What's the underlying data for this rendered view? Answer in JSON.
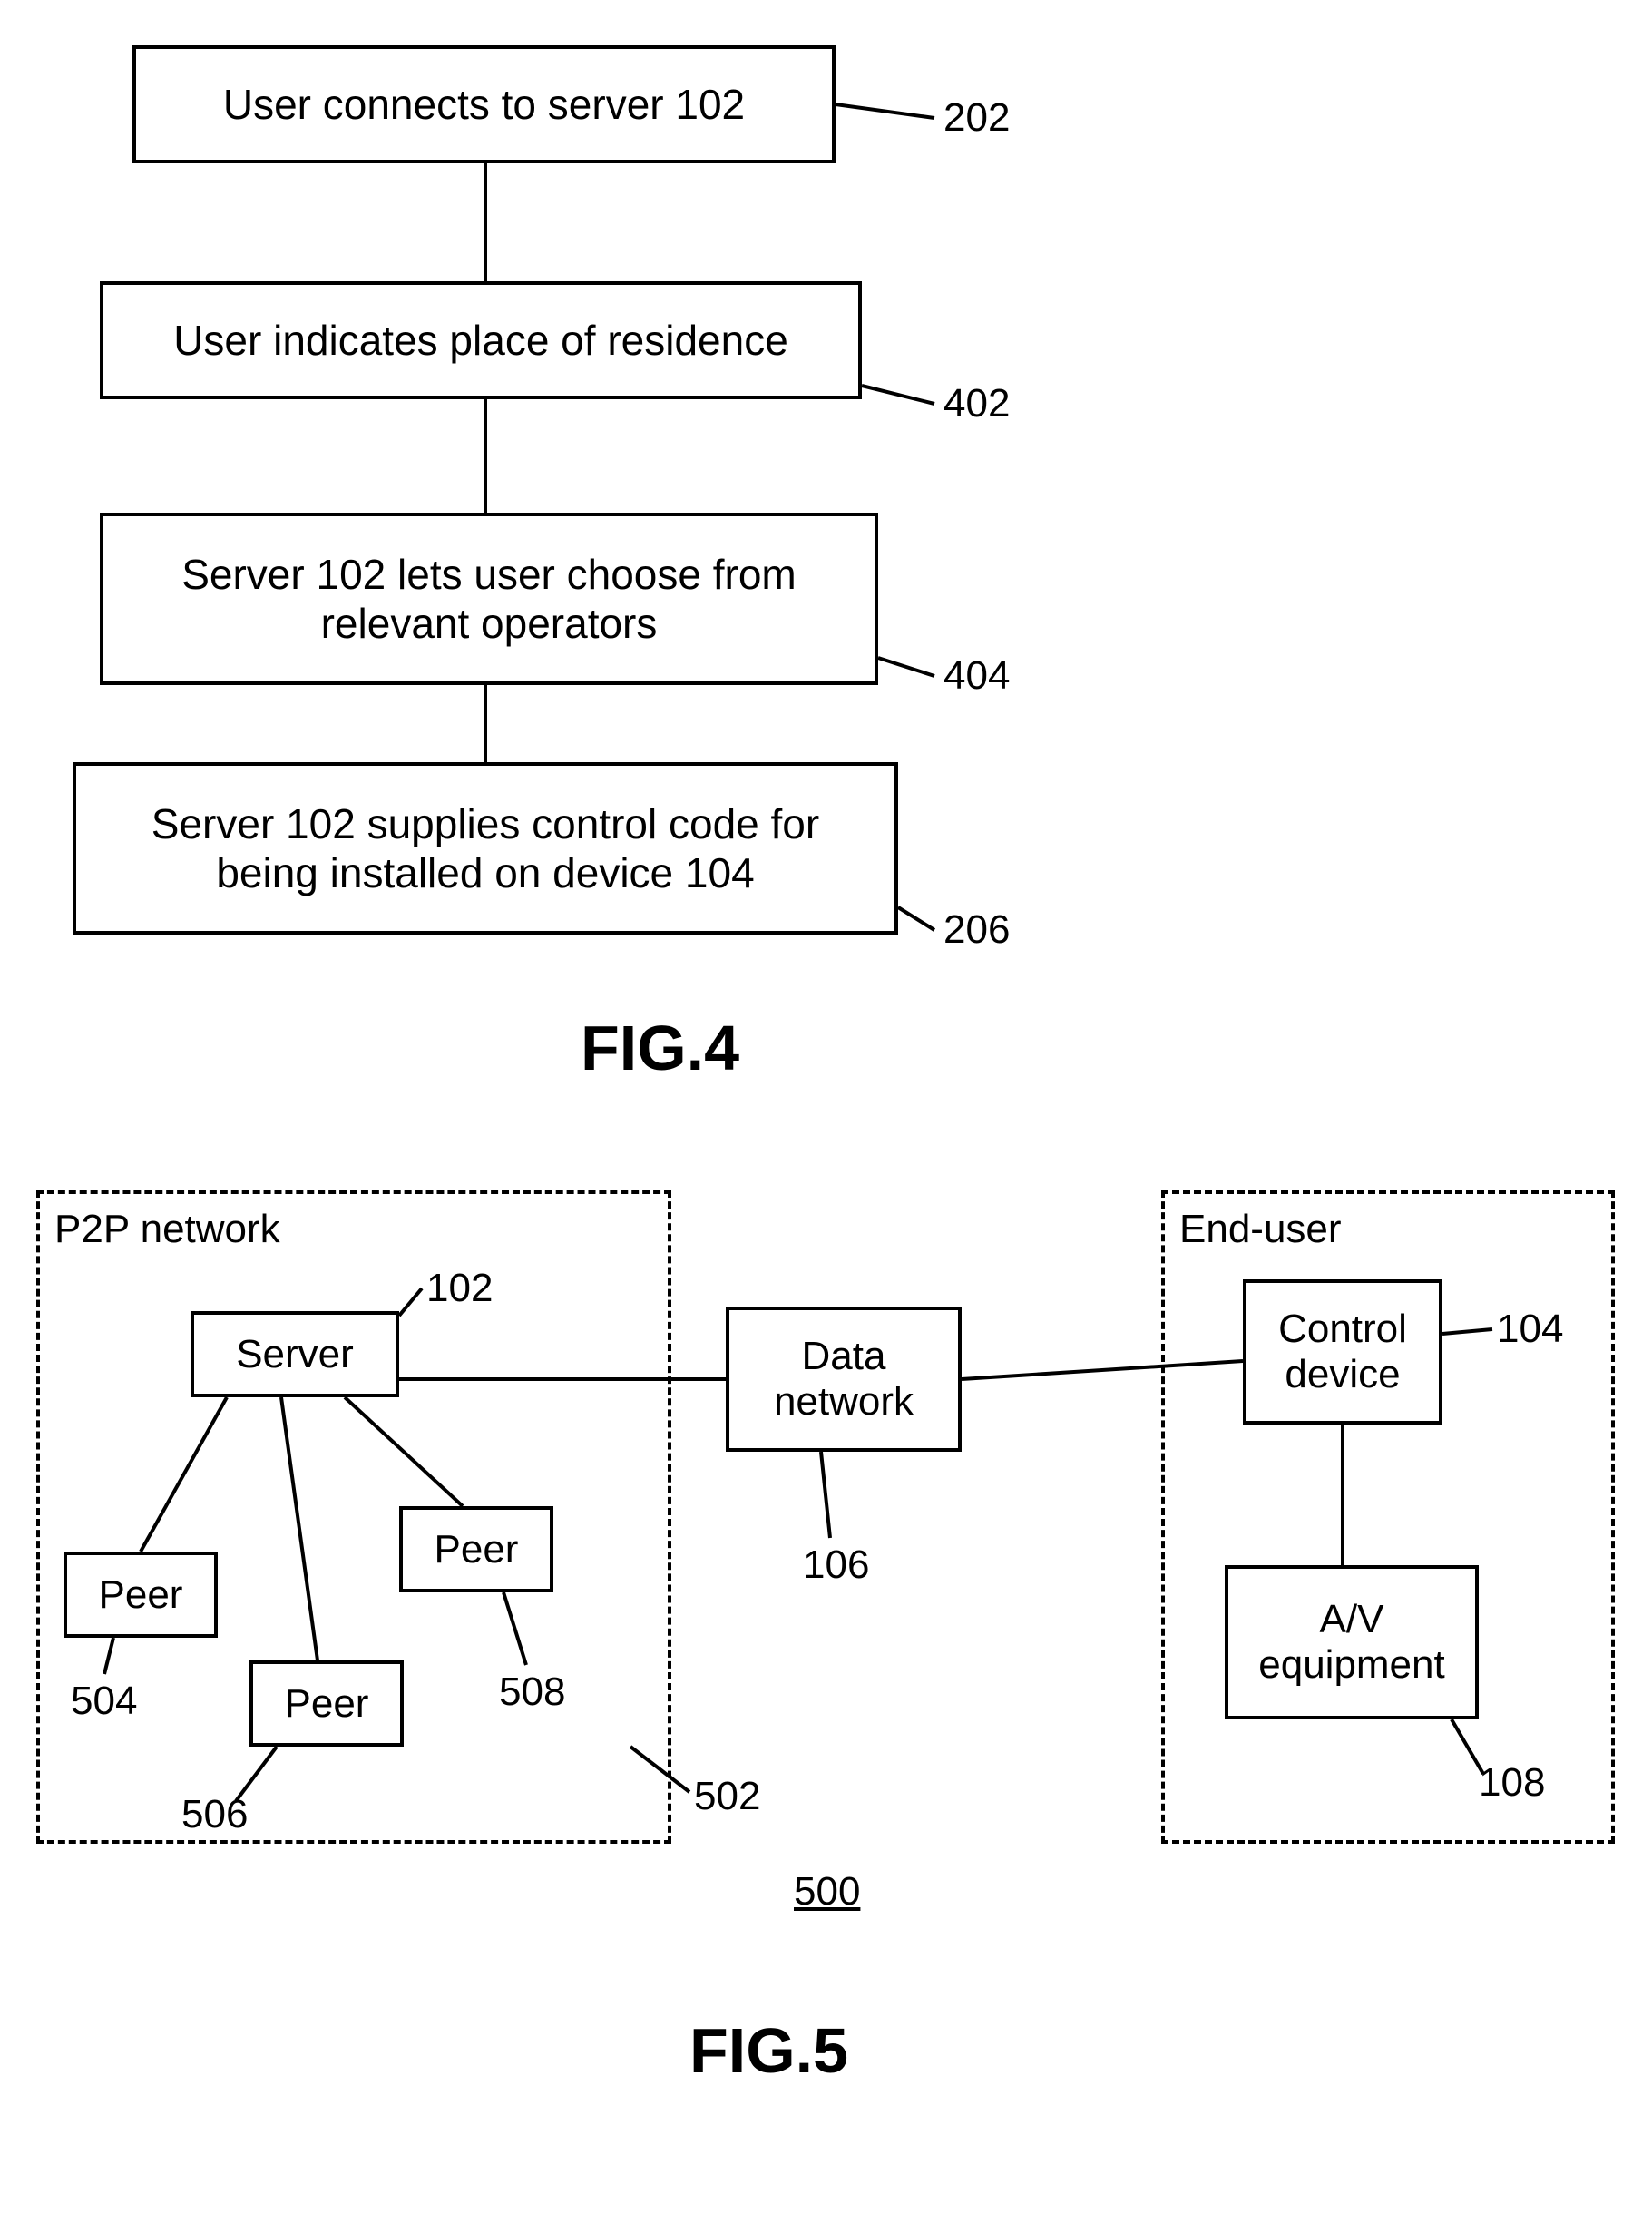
{
  "fig4": {
    "step1": "User connects to server 102",
    "step2": "User indicates place of residence",
    "step3": "Server 102 lets user choose from relevant operators",
    "step4": "Server 102 supplies control code for being installed on device 104",
    "ref202": "202",
    "ref402": "402",
    "ref404": "404",
    "ref206": "206",
    "caption": "FIG.4"
  },
  "fig5": {
    "p2p_title": "P2P network",
    "enduser_title": "End-user",
    "server": "Server",
    "peer": "Peer",
    "data_network": "Data network",
    "control_device": "Control device",
    "av_equipment": "A/V equipment",
    "ref102": "102",
    "ref104": "104",
    "ref106": "106",
    "ref108": "108",
    "ref502": "502",
    "ref504": "504",
    "ref506": "506",
    "ref508": "508",
    "ref500": "500",
    "caption": "FIG.5"
  }
}
